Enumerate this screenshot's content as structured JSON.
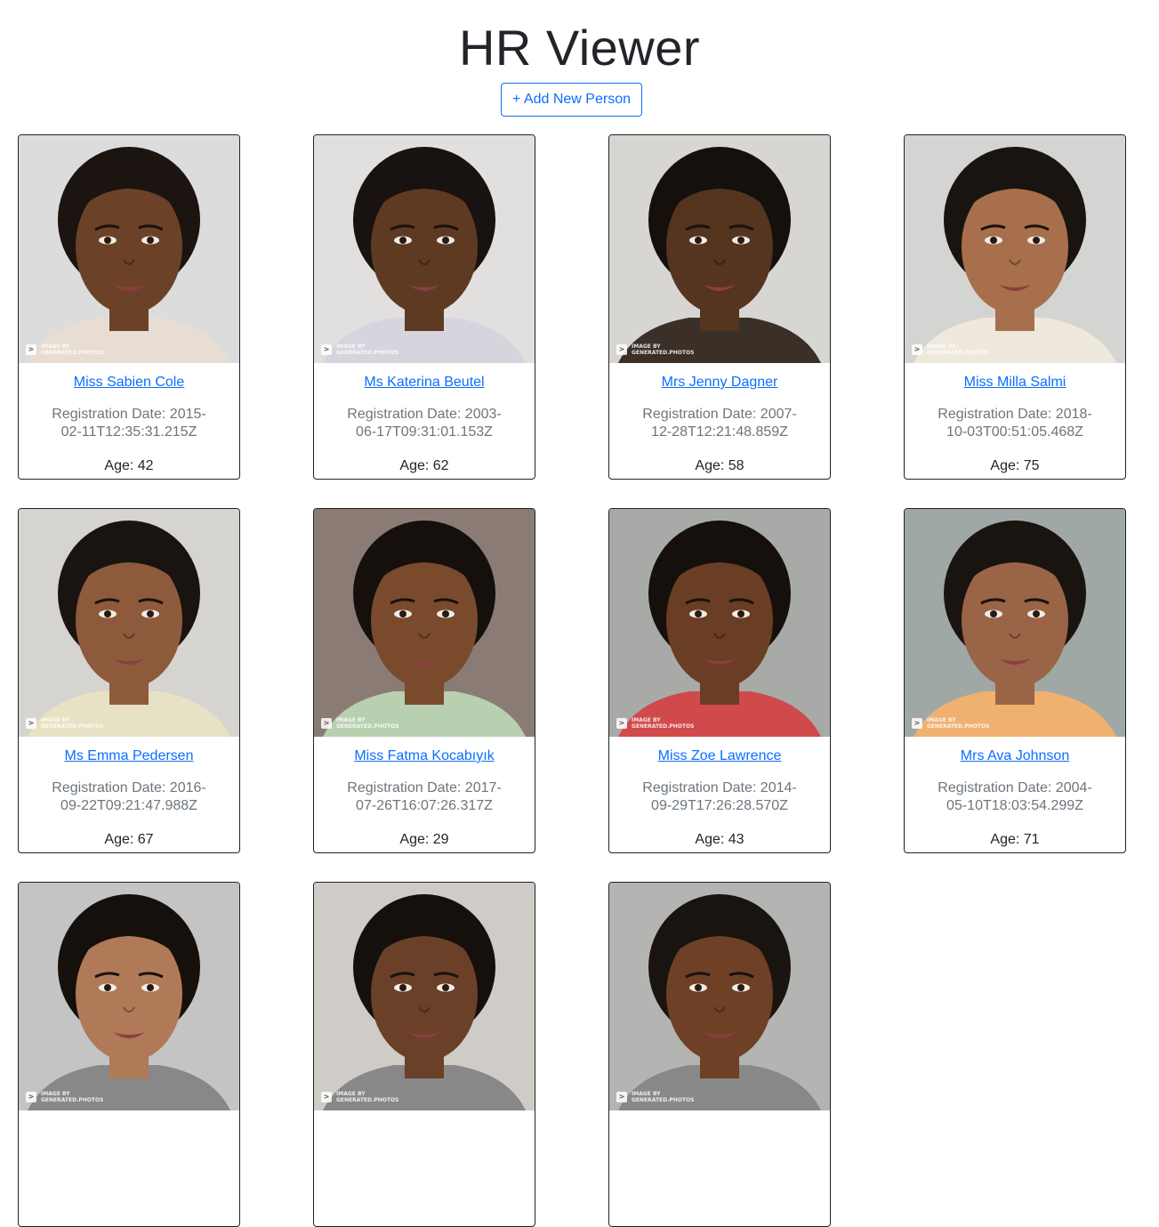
{
  "header": {
    "title": "HR Viewer",
    "add_button": "+ Add New Person"
  },
  "watermark": {
    "line1": "IMAGE BY",
    "line2": "GENERATED.PHOTOS"
  },
  "people": [
    {
      "name": "Miss Sabien Cole",
      "registration": "Registration Date: 2015-02-11T12:35:31.215Z",
      "age": "Age: 42",
      "photo": {
        "background": "#dcdcdc",
        "skin": "#6b4228",
        "hair": "#1c1410",
        "shirt": "#e8ddd2"
      }
    },
    {
      "name": "Ms Katerina Beutel",
      "registration": "Registration Date: 2003-06-17T09:31:01.153Z",
      "age": "Age: 62",
      "photo": {
        "background": "#e2e0de",
        "skin": "#5e3a22",
        "hair": "#181210",
        "shirt": "#d6d4dc"
      }
    },
    {
      "name": "Mrs Jenny Dagner",
      "registration": "Registration Date: 2007-12-28T12:21:48.859Z",
      "age": "Age: 58",
      "photo": {
        "background": "#d8d6d2",
        "skin": "#553420",
        "hair": "#15100c",
        "shirt": "#3a3028"
      }
    },
    {
      "name": "Miss Milla Salmi",
      "registration": "Registration Date: 2018-10-03T00:51:05.468Z",
      "age": "Age: 75",
      "photo": {
        "background": "#d4d4d2",
        "skin": "#a86f4c",
        "hair": "#1a1410",
        "shirt": "#efe8dc"
      }
    },
    {
      "name": "Ms Emma Pedersen",
      "registration": "Registration Date: 2016-09-22T09:21:47.988Z",
      "age": "Age: 67",
      "photo": {
        "background": "#d6d4d0",
        "skin": "#8e5a3c",
        "hair": "#1a1410",
        "shirt": "#e8e2c4"
      }
    },
    {
      "name": "Miss Fatma Kocabıyık",
      "registration": "Registration Date: 2017-07-26T16:07:26.317Z",
      "age": "Age: 29",
      "photo": {
        "background": "#8a7c74",
        "skin": "#7a4a2c",
        "hair": "#15100c",
        "shirt": "#b8d0b0"
      }
    },
    {
      "name": "Miss Zoe Lawrence",
      "registration": "Registration Date: 2014-09-29T17:26:28.570Z",
      "age": "Age: 43",
      "photo": {
        "background": "#a8aaa8",
        "skin": "#6a3e24",
        "hair": "#15100c",
        "shirt": "#d04a4c"
      }
    },
    {
      "name": "Mrs Ava Johnson",
      "registration": "Registration Date: 2004-05-10T18:03:54.299Z",
      "age": "Age: 71",
      "photo": {
        "background": "#9fa8a4",
        "skin": "#9a6446",
        "hair": "#1a1410",
        "shirt": "#f0b070"
      }
    },
    {
      "name": "",
      "registration": "",
      "age": "",
      "photo": {
        "background": "#c4c4c4",
        "skin": "#b07a58",
        "hair": "#16100c",
        "shirt": "#888888"
      }
    },
    {
      "name": "",
      "registration": "",
      "age": "",
      "photo": {
        "background": "#cfcbc6",
        "skin": "#6a4028",
        "hair": "#15100c",
        "shirt": "#888888"
      }
    },
    {
      "name": "",
      "registration": "",
      "age": "",
      "photo": {
        "background": "#b4b4b2",
        "skin": "#6e4026",
        "hair": "#1a1410",
        "shirt": "#888888"
      }
    }
  ]
}
